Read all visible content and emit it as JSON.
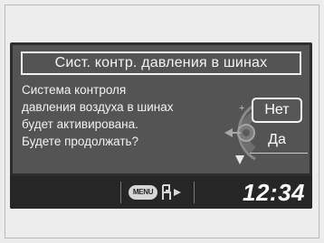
{
  "dialog": {
    "title": "Сист. контр. давления в шинах",
    "message_lines": [
      "Система контроля",
      "давления воздуха в шинах",
      "будет активирована.",
      "Будете продолжать?"
    ],
    "options": {
      "no": "Нет",
      "yes": "Да"
    },
    "selected_option": "Нет"
  },
  "status_bar": {
    "menu_label": "MENU",
    "menu_icon": "menu-button-icon",
    "seat_icon": "seat-arrow-icon",
    "time": "12:34"
  },
  "dial": {
    "icon": "selector-dial-icon",
    "up_label": "+",
    "down_label": "−"
  }
}
